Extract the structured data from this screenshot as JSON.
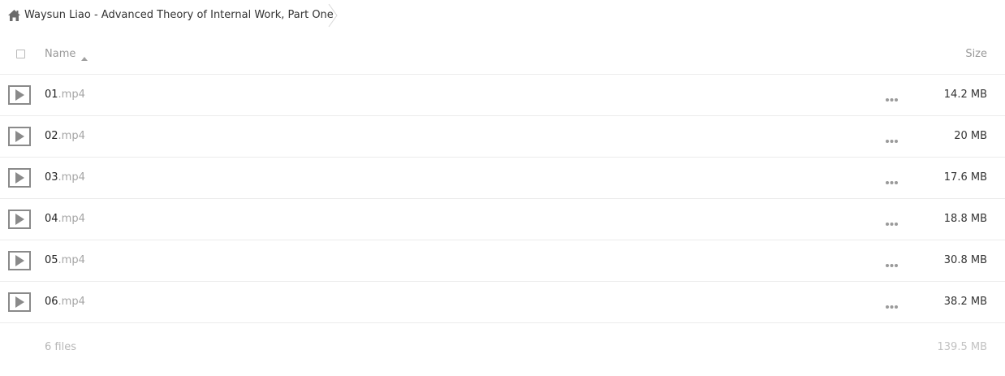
{
  "breadcrumb": {
    "home_icon": "home-icon",
    "title": "Waysun Liao - Advanced Theory of Internal Work, Part One"
  },
  "header": {
    "name_label": "Name",
    "size_label": "Size",
    "sort_direction": "ascending"
  },
  "files": [
    {
      "base": "01",
      "ext": ".mp4",
      "size": "14.2 MB"
    },
    {
      "base": "02",
      "ext": ".mp4",
      "size": "20 MB"
    },
    {
      "base": "03",
      "ext": ".mp4",
      "size": "17.6 MB"
    },
    {
      "base": "04",
      "ext": ".mp4",
      "size": "18.8 MB"
    },
    {
      "base": "05",
      "ext": ".mp4",
      "size": "30.8 MB"
    },
    {
      "base": "06",
      "ext": ".mp4",
      "size": "38.2 MB"
    }
  ],
  "summary": {
    "count": "6 files",
    "total_size": "139.5 MB"
  },
  "colors": {
    "text_primary": "#222222",
    "text_muted": "#999999",
    "extension": "#a5a5a5",
    "divider": "#ececec",
    "icon_gray": "#8a8a8a"
  }
}
